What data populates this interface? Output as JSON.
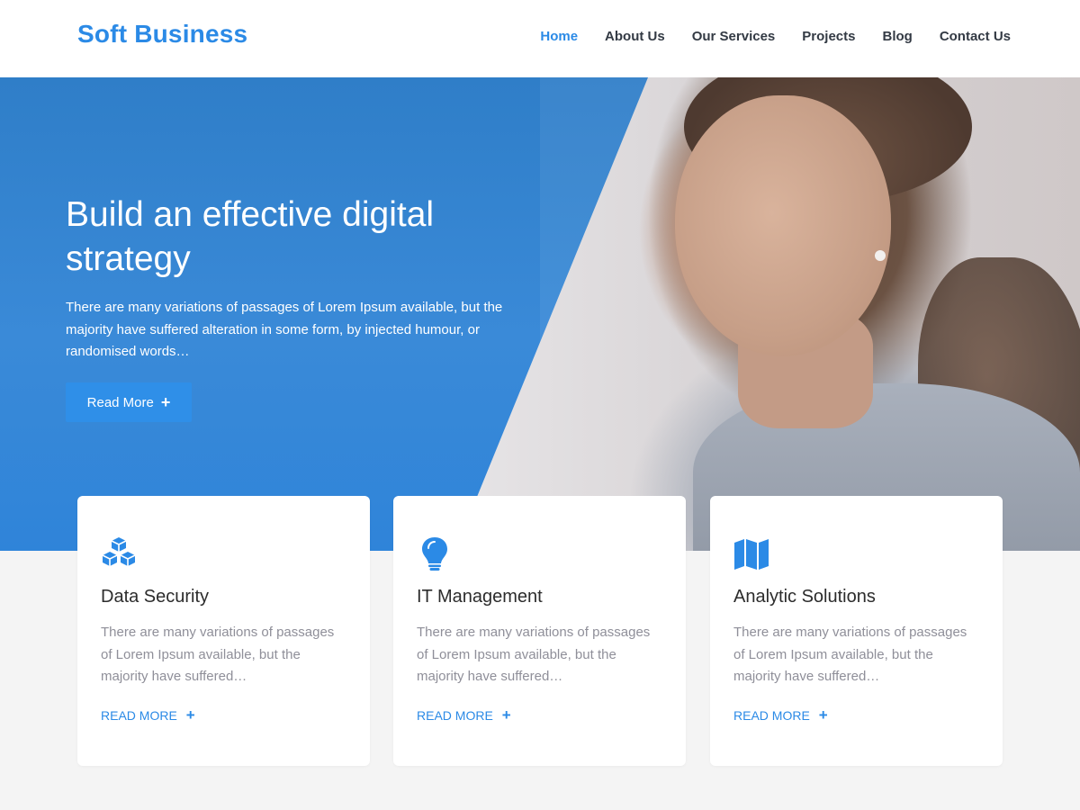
{
  "header": {
    "logo": "Soft Business",
    "nav": [
      "Home",
      "About Us",
      "Our Services",
      "Projects",
      "Blog",
      "Contact Us"
    ],
    "active_nav": "Home"
  },
  "hero": {
    "title": "Build an effective digital strategy",
    "text": "There are many variations of passages of Lorem Ipsum available, but the majority have suffered alteration in some form, by injected humour, or randomised words…",
    "button_label": "Read More"
  },
  "cards": [
    {
      "icon": "cubes-icon",
      "title": "Data Security",
      "text": "There are many variations of passages of Lorem Ipsum available, but the majority have suffered…",
      "link": "READ MORE"
    },
    {
      "icon": "lightbulb-icon",
      "title": "IT Management",
      "text": "There are many variations of passages of Lorem Ipsum available, but the majority have suffered…",
      "link": "READ MORE"
    },
    {
      "icon": "map-icon",
      "title": "Analytic Solutions",
      "text": "There are many variations of passages of Lorem Ipsum available, but the majority have suffered…",
      "link": "READ MORE"
    }
  ],
  "colors": {
    "accent": "#2b8ae6",
    "hero_blue": "#3a8ad8",
    "heading": "#2c2c2c",
    "muted_text": "#8f8f99",
    "page_bg": "#f4f4f4"
  }
}
